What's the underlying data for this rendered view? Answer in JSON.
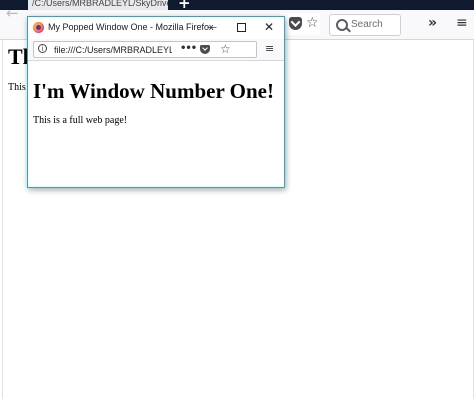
{
  "main_window": {
    "tab": {
      "title": "/C:/Users/MRBRADLEYL/SkyDrive/",
      "close_glyph": "×"
    },
    "new_tab_glyph": "+",
    "back_glyph": "←",
    "search": {
      "placeholder": "Search"
    },
    "star_glyph": "☆",
    "overflow_glyph": "»",
    "menu_glyph": "≡",
    "content": {
      "heading": "Th",
      "paragraph": "This"
    }
  },
  "popup_window": {
    "title": "My Popped Window One - Mozilla Firefox",
    "controls": {
      "minimize_glyph": "—",
      "close_glyph": "✕"
    },
    "url": "file:///C:/Users/MRBRADLEYL/SkyDrive",
    "info_glyph": "i",
    "dots_glyph": "•••",
    "star_glyph": "☆",
    "menu_glyph": "≡",
    "content": {
      "heading": "I'm Window Number One!",
      "paragraph": "This is a full web page!"
    }
  }
}
